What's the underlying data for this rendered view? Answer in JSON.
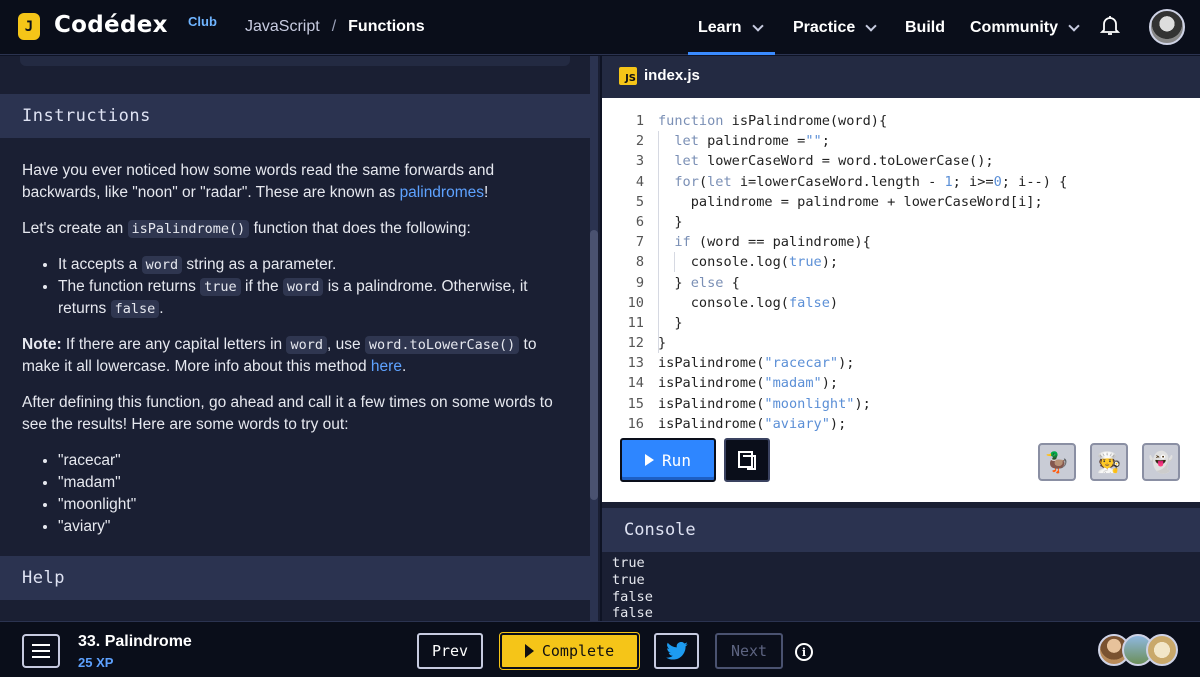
{
  "topbar": {
    "logo_glyph": "J",
    "brand": "Codédex",
    "brand_sub": "Club",
    "breadcrumb": {
      "course": "JavaScript",
      "separator": "/",
      "lesson": "Functions"
    },
    "nav": [
      {
        "label": "Learn",
        "dropdown": true,
        "active": true
      },
      {
        "label": "Practice",
        "dropdown": true
      },
      {
        "label": "Build",
        "dropdown": false
      },
      {
        "label": "Community",
        "dropdown": true
      }
    ],
    "icons": {
      "notifications": "bell-icon",
      "profile": "user-avatar"
    }
  },
  "instructions": {
    "heading": "Instructions",
    "p1_a": "Have you ever noticed how some words read the same forwards and backwards, like \"noon\" or \"radar\". These are known as ",
    "p1_link": "palindromes",
    "p1_b": "!",
    "p2_a": "Let's create an ",
    "p2_code": "isPalindrome()",
    "p2_b": " function that does the following:",
    "b1_a": "It accepts a ",
    "b1_code": "word",
    "b1_b": " string as a parameter.",
    "b2_a": "The function returns ",
    "b2_code1": "true",
    "b2_b": " if the ",
    "b2_code2": "word",
    "b2_c": " is a palindrome. Otherwise, it returns ",
    "b2_code3": "false",
    "b2_d": ".",
    "note_label": "Note:",
    "note_a": " If there are any capital letters in ",
    "note_code1": "word",
    "note_b": ", use ",
    "note_code2": "word.toLowerCase()",
    "note_c": " to make it all lowercase. More info about this method ",
    "note_link": "here",
    "note_d": ".",
    "p4": "After defining this function, go ahead and call it a few times on some words to see the results! Here are some words to try out:",
    "words": [
      "\"racecar\"",
      "\"madam\"",
      "\"moonlight\"",
      "\"aviary\""
    ]
  },
  "help": {
    "heading": "Help"
  },
  "editor": {
    "filename": "index.js",
    "file_icon": "JS",
    "line_numbers": [
      "1",
      "2",
      "3",
      "4",
      "5",
      "6",
      "7",
      "8",
      "9",
      "10",
      "11",
      "12",
      "13",
      "14",
      "15",
      "16"
    ],
    "run_label": "Run",
    "copy_icon": "copy-icon",
    "mascots": [
      "duck-mascot-icon",
      "chef-mascot-icon",
      "ghost-mascot-icon"
    ]
  },
  "console": {
    "heading": "Console",
    "lines": [
      "true",
      "true",
      "false",
      "false"
    ]
  },
  "bottombar": {
    "lesson_title": "33. Palindrome",
    "xp": "25 XP",
    "prev_label": "Prev",
    "complete_label": "Complete",
    "next_label": "Next",
    "share_icon": "twitter-icon",
    "info_icon": "info-icon"
  },
  "colors": {
    "accent_blue": "#2e86ff",
    "complete_yellow": "#f5c518",
    "link_blue": "#5ea2ff",
    "panel_bg": "#1a1f33",
    "header_bg": "#2b3350"
  }
}
